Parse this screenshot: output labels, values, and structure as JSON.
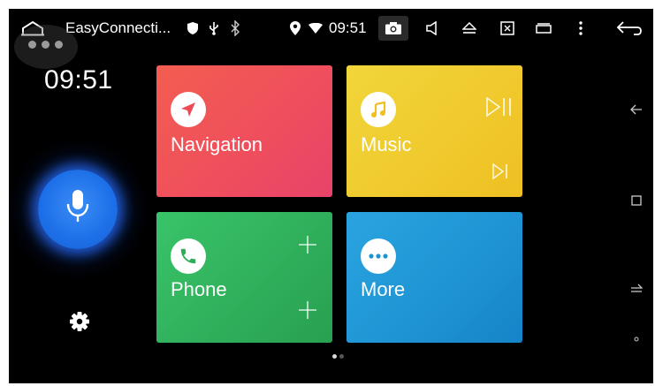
{
  "statusbar": {
    "app_title": "EasyConnecti...",
    "time": "09:51"
  },
  "clock": {
    "time": "09:51"
  },
  "tiles": {
    "navigation": {
      "label": "Navigation"
    },
    "music": {
      "label": "Music"
    },
    "phone": {
      "label": "Phone"
    },
    "more": {
      "label": "More"
    }
  },
  "pager": {
    "pages": 2,
    "current": 1
  },
  "colors": {
    "navigation": "#ef4f5c",
    "music": "#f0c92d",
    "phone": "#2fae5a",
    "more": "#1e93d3",
    "mic": "#1d6fe8"
  },
  "icons": {
    "statusbar": [
      "home-icon",
      "shield-icon",
      "usb-icon",
      "bluetooth-icon",
      "location-icon",
      "wifi-icon",
      "camera-icon",
      "volume-icon",
      "eject-icon",
      "screenshot-icon",
      "window-icon",
      "more-vert-icon",
      "back-icon"
    ],
    "side_nav": [
      "arrow-left-icon",
      "square-icon",
      "switch-icon",
      "small-circle-icon"
    ]
  }
}
